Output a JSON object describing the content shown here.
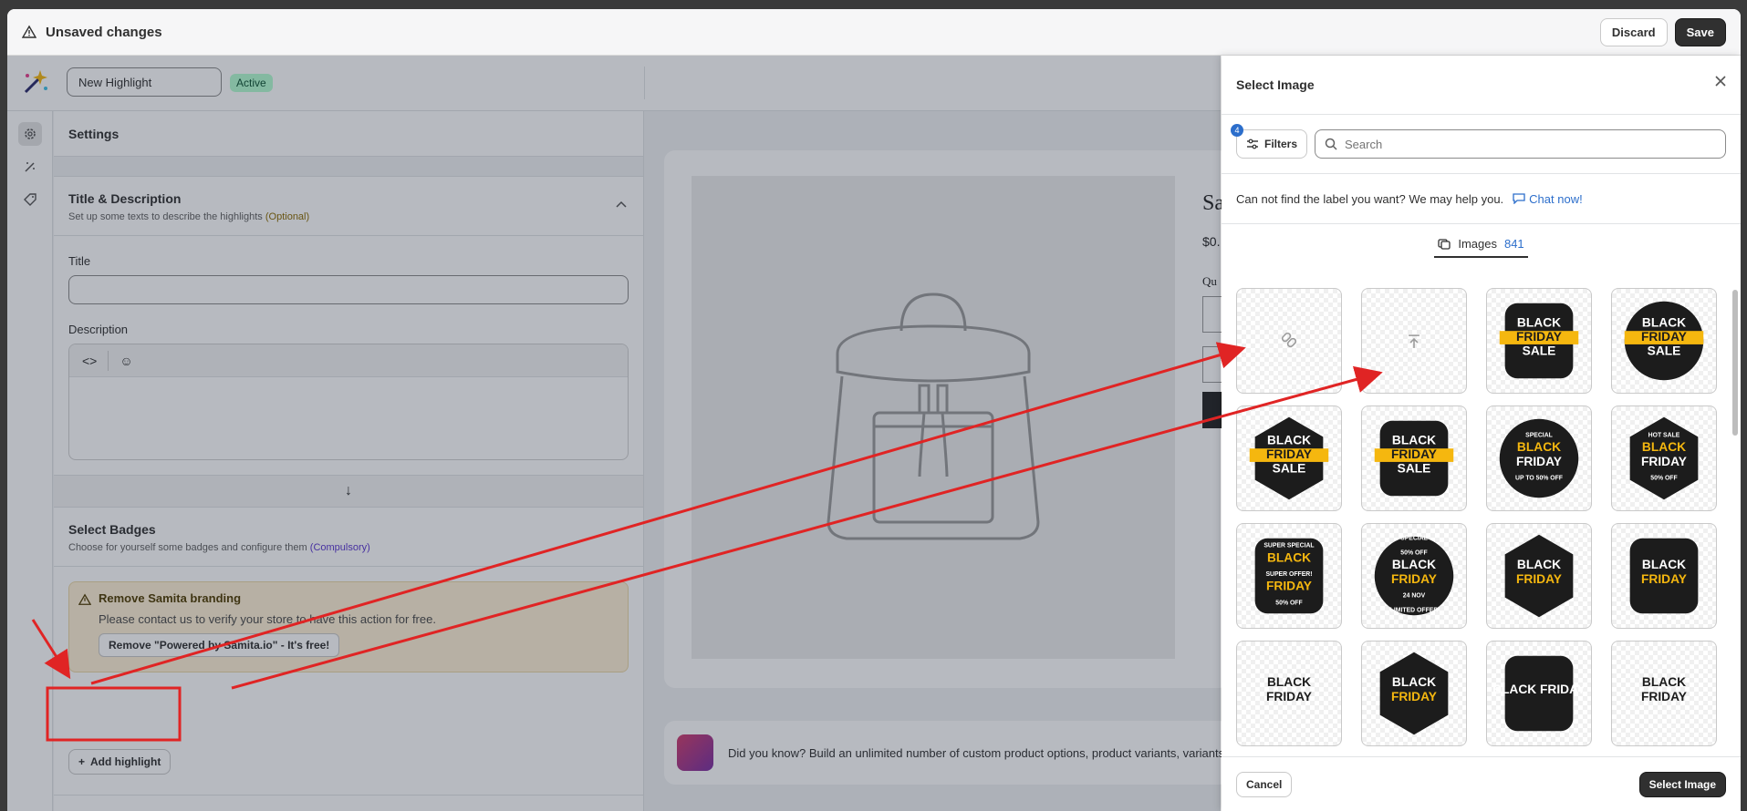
{
  "topbar": {
    "title": "Unsaved changes",
    "discard": "Discard",
    "save": "Save"
  },
  "app": {
    "name_value": "New Highlight",
    "status": "Active"
  },
  "settings": {
    "header": "Settings",
    "title_desc": {
      "title": "Title & Description",
      "subtitle": "Set up some texts to describe the highlights",
      "optional": "(Optional)"
    },
    "title_label": "Title",
    "description_label": "Description",
    "badges": {
      "title": "Select Badges",
      "subtitle": "Choose for yourself some badges and configure them",
      "compulsory": "(Compulsory)"
    },
    "banner": {
      "title": "Remove Samita branding",
      "desc": "Please contact us to verify your store to have this action for free.",
      "button": "Remove \"Powered by Samita.io\" - It's free!"
    },
    "add_highlight": "Add highlight"
  },
  "preview": {
    "title": "Sa",
    "price": "$0.",
    "qty_label": "Qu",
    "tip": "Did you know? Build an unlimited number of custom product options, product variants, variants"
  },
  "modal": {
    "title": "Select Image",
    "filters_label": "Filters",
    "filters_count": "4",
    "search_placeholder": "Search",
    "help_text": "Can not find the label you want? We may help you.",
    "chat_link": "Chat now!",
    "tab_label": "Images",
    "tab_count": "841",
    "cancel": "Cancel",
    "select": "Select Image"
  },
  "tiles": [
    {
      "kind": "link-icon"
    },
    {
      "kind": "upload-icon"
    },
    {
      "kind": "badge",
      "lines": [
        "BLACK",
        "FRIDAY",
        "SALE"
      ]
    },
    {
      "kind": "badge",
      "lines": [
        "BLACK",
        "FRIDAY",
        "SALE"
      ]
    },
    {
      "kind": "badge",
      "lines": [
        "BLACK",
        "FRIDAY",
        "SALE"
      ]
    },
    {
      "kind": "badge",
      "lines": [
        "BLACK",
        "FRIDAY",
        "SALE"
      ]
    },
    {
      "kind": "badge",
      "lines": [
        "SPECIAL",
        "BLACK",
        "FRIDAY",
        "UP TO 50% OFF"
      ]
    },
    {
      "kind": "badge",
      "lines": [
        "HOT SALE",
        "BLACK",
        "FRIDAY",
        "50% OFF"
      ]
    },
    {
      "kind": "badge",
      "lines": [
        "SUPER SPECIAL",
        "BLACK",
        "SUPER OFFER!",
        "FRIDAY",
        "50% OFF"
      ]
    },
    {
      "kind": "badge",
      "lines": [
        "SPECIAL",
        "50% OFF",
        "BLACK",
        "FRIDAY",
        "24 NOV",
        "LIMITED OFFER"
      ]
    },
    {
      "kind": "badge",
      "lines": [
        "BLACK",
        "FRIDAY"
      ]
    },
    {
      "kind": "badge",
      "lines": [
        "BLACK",
        "FRIDAY"
      ]
    },
    {
      "kind": "badge",
      "lines": [
        "BLACK",
        "FRIDAY"
      ]
    },
    {
      "kind": "badge",
      "lines": [
        "BLACK",
        "FRIDAY"
      ]
    },
    {
      "kind": "badge",
      "lines": [
        "BLACK FRIDAY"
      ]
    },
    {
      "kind": "badge",
      "lines": [
        "BLACK",
        "FRIDAY"
      ]
    }
  ],
  "colors": {
    "accent": "#2c6ecb",
    "annotation": "#e02424",
    "badge_yellow": "#f5b70f",
    "badge_dark": "#1c1c1c"
  }
}
